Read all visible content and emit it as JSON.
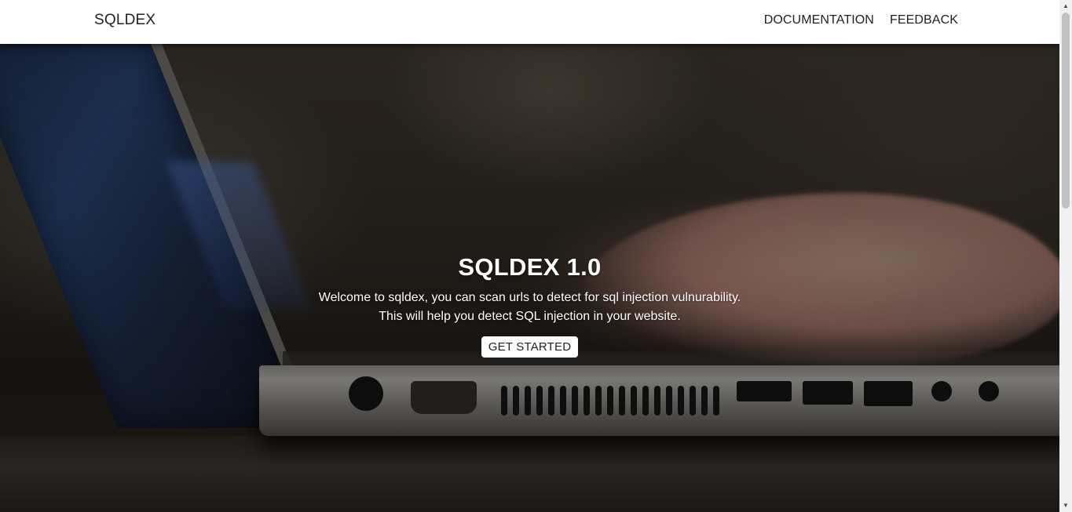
{
  "navbar": {
    "brand": "SQLDEX",
    "links": [
      {
        "label": "DOCUMENTATION"
      },
      {
        "label": "FEEDBACK"
      }
    ]
  },
  "hero": {
    "title": "SQLDEX 1.0",
    "line1": "Welcome to sqldex, you can scan urls to detect for sql injection vulnurability.",
    "line2": "This will help you detect SQL injection in your website.",
    "cta_label": "GET STARTED",
    "background_image": "laptop-typing-photo"
  },
  "scrollbar": {
    "up_icon": "▲",
    "down_icon": "▼"
  },
  "colors": {
    "navbar_bg": "#ffffff",
    "nav_text": "#222222",
    "hero_text": "#ffffff",
    "button_bg": "#ffffff"
  }
}
